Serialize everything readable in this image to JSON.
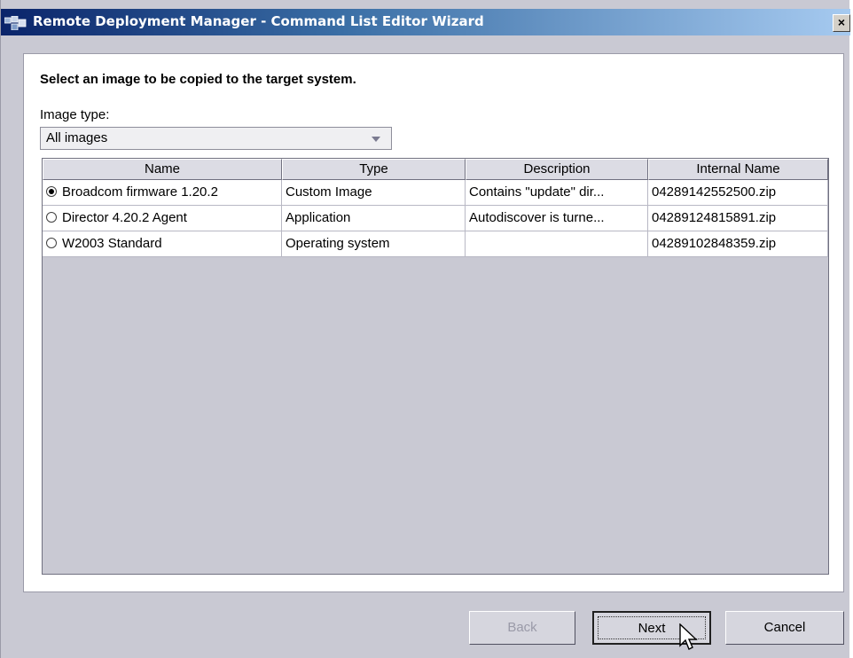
{
  "window": {
    "title": "Remote Deployment Manager - Command List Editor Wizard",
    "close_glyph": "×"
  },
  "content": {
    "heading": "Select an image to be copied to the target system.",
    "image_type_label": "Image type:",
    "image_type_selected": "All images"
  },
  "table": {
    "columns": [
      "Name",
      "Type",
      "Description",
      "Internal Name"
    ],
    "rows": [
      {
        "selected": true,
        "name": "Broadcom firmware 1.20.2",
        "type": "Custom Image",
        "description": "Contains \"update\" dir...",
        "internal_name": "04289142552500.zip"
      },
      {
        "selected": false,
        "name": "Director 4.20.2 Agent",
        "type": "Application",
        "description": "Autodiscover is turne...",
        "internal_name": "04289124815891.zip"
      },
      {
        "selected": false,
        "name": "W2003 Standard",
        "type": "Operating system",
        "description": "",
        "internal_name": "04289102848359.zip"
      }
    ]
  },
  "buttons": {
    "back": "Back",
    "next": "Next",
    "cancel": "Cancel"
  },
  "colors": {
    "title_gradient_start": "#0a246a",
    "window_bg": "#c9c9d3"
  }
}
